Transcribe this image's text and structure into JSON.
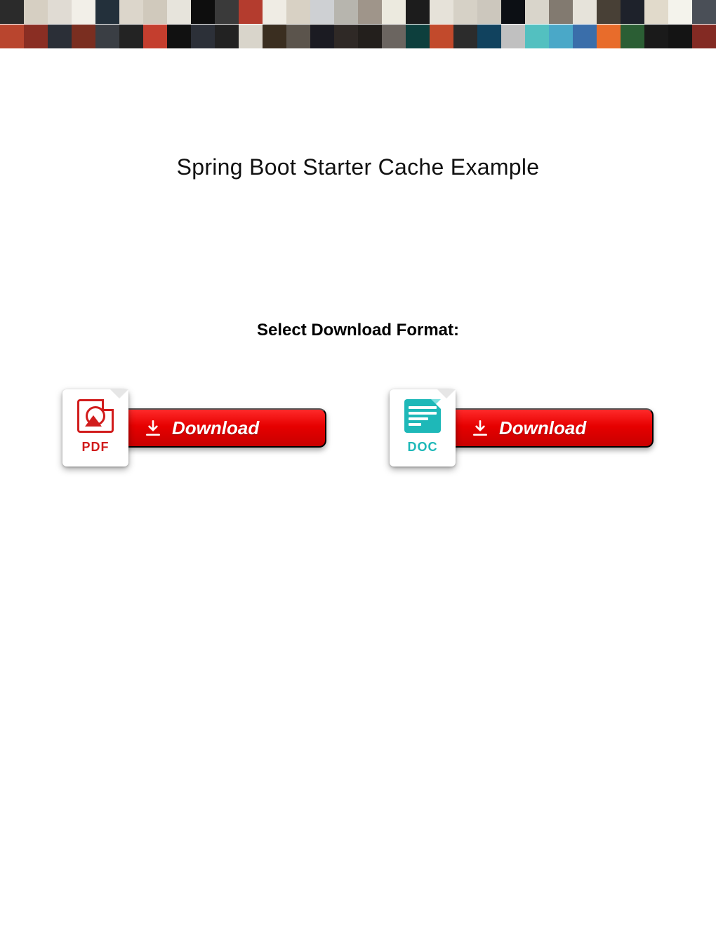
{
  "header": {
    "collage_tile_colors": [
      "#2b2b2b",
      "#d6cfc2",
      "#e0dbd3",
      "#f2efe8",
      "#23303b",
      "#dcd6cb",
      "#d0c9bc",
      "#e7e4dc",
      "#0e0e0e",
      "#3a3a3a",
      "#b43c2e",
      "#efece4",
      "#d8d1c4",
      "#ced0d3",
      "#b7b5ae",
      "#9f958a",
      "#eceadf",
      "#1c1c1c",
      "#e6e2d9",
      "#d6d1c6",
      "#ccc7bd",
      "#0c0f14",
      "#d9d5cb",
      "#827a70",
      "#e6e3da",
      "#484036",
      "#1e222b",
      "#e1dacb",
      "#f4f3ec",
      "#4a4f57",
      "#b9452e",
      "#8a2e23",
      "#2b2f37",
      "#7a2e20",
      "#3a3e44",
      "#232323",
      "#c43e2e",
      "#111111",
      "#2c3038",
      "#222222",
      "#d9d5cb",
      "#3a2e20",
      "#5b544c",
      "#1b1b22",
      "#2f2926",
      "#231f1c",
      "#6b6560",
      "#0d3f3d",
      "#c24a2c",
      "#2c2c2c",
      "#11425e",
      "#c0c0c0",
      "#53c0c0",
      "#4aa8c8",
      "#3a6eaa",
      "#e86c2b",
      "#2b5e34",
      "#1a1a1a",
      "#141414",
      "#832a23"
    ]
  },
  "title": "Spring Boot Starter Cache Example",
  "section_heading": "Select Download Format:",
  "buttons": {
    "pdf": {
      "badge": "PDF",
      "label": "Download",
      "icon_semantic": "pdf-file-icon"
    },
    "doc": {
      "badge": "DOC",
      "label": "Download",
      "icon_semantic": "doc-file-icon"
    }
  },
  "colors": {
    "download_red_top": "#ff2a2a",
    "download_red_bottom": "#c80000",
    "pdf": "#d11c1c",
    "doc": "#1eb8b8"
  }
}
